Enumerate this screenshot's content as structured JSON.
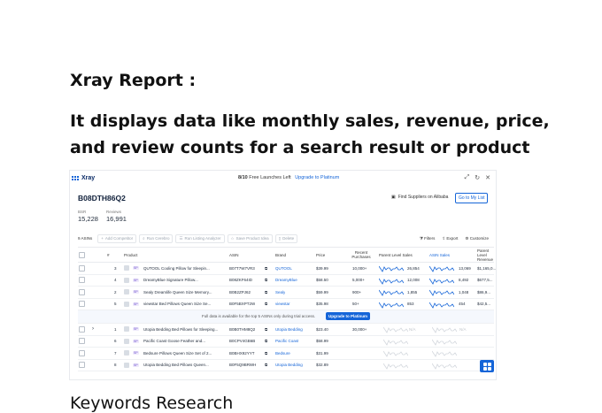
{
  "doc": {
    "heading": "Xray Report :",
    "description": "It displays data like monthly sales, revenue, price, and review counts for a search result or product page.",
    "next_heading": "Keywords Research"
  },
  "app": {
    "name": "Xray",
    "launches": "8/10",
    "launches_text": "Free Launches Left",
    "upgrade_link": "Upgrade to Platinum",
    "asin": "B08DTH86Q2",
    "bsr_label": "BSR",
    "bsr_value": "15,228",
    "reviews_label": "Reviews",
    "reviews_value": "16,991",
    "supplier_link": "Find Suppliers on Alibaba",
    "go_list": "Go to My List"
  },
  "toolbar": {
    "count": "9 ASINs",
    "buttons": [
      "Add Competitor",
      "Run Cerebro",
      "Run Listing Analyzer",
      "Save Product Idea",
      "Delete"
    ],
    "filters": "Filters",
    "export": "Export",
    "customize": "Customize"
  },
  "columns": [
    "#",
    "Product",
    "ASIN",
    "Brand",
    "Price",
    "Recent Purchases",
    "Parent Level Sales",
    "ASIN Sales",
    "Parent Level Revenue"
  ],
  "rows": [
    {
      "num": "3",
      "tag": "SP",
      "product": "QUTOOL Cooling Pillow for Sleepin...",
      "asin": "B07T7W7VR3",
      "brand": "QUTOOL",
      "price": "$39.99",
      "recent": "10,000+",
      "parent_sales": "26,854",
      "asin_sales": "13,069",
      "parent_rev": "$1,165,0..."
    },
    {
      "num": "4",
      "tag": "SP",
      "product": "DreamyBlue Signature Pillow...",
      "asin": "B08ZKF64ID",
      "brand": "DreamyBlue",
      "price": "$58.50",
      "recent": "5,000+",
      "parent_sales": "12,008",
      "asin_sales": "8,492",
      "parent_rev": "$677,5..."
    },
    {
      "num": "2",
      "tag": "SP",
      "product": "Sealy Dreamlife Queen Size Memory...",
      "asin": "B0B2ZPJ62",
      "brand": "Sealy",
      "price": "$59.99",
      "recent": "900+",
      "parent_sales": "1,855",
      "asin_sales": "1,048",
      "parent_rev": "$86,9..."
    },
    {
      "num": "5",
      "tag": "SP",
      "product": "viewstar Bed Pillows Queen Size Se...",
      "asin": "B0F5BXPT2W",
      "brand": "viewstar",
      "price": "$35.98",
      "recent": "50+",
      "parent_sales": "853",
      "asin_sales": "454",
      "parent_rev": "$42,5..."
    }
  ],
  "banner": {
    "message": "Full data is available for the top 5 ASINs only during trial access.",
    "button": "Upgrade to Platinum"
  },
  "locked_rows": [
    {
      "num": "1",
      "tag": "SP",
      "product": "Utopia Bedding Bed Pillows for Sleeping...",
      "asin": "B0B0THM8Q2",
      "brand": "Utopia Bedding",
      "price": "$23.40",
      "recent": "30,000+",
      "parent_sales": "N/A",
      "asin_sales": "N/A"
    },
    {
      "num": "6",
      "tag": "SP",
      "product": "Pacific Coast Goose Feather and...",
      "asin": "B0CPV4GB6B",
      "brand": "Pacific Coast",
      "price": "$58.99",
      "recent": "",
      "parent_sales": "",
      "asin_sales": ""
    },
    {
      "num": "7",
      "tag": "SP",
      "product": "Bedsure Pillows Queen Size Set of 2...",
      "asin": "B0BHX92YYT",
      "brand": "Bedsure",
      "price": "$31.99",
      "recent": "",
      "parent_sales": "",
      "asin_sales": ""
    },
    {
      "num": "8",
      "tag": "SP",
      "product": "Utopia Bedding Bed Pillows Queen...",
      "asin": "B0F5Q9BRWH",
      "brand": "Utopia Bedding",
      "price": "$32.89",
      "recent": "",
      "parent_sales": "",
      "asin_sales": ""
    }
  ],
  "colors": {
    "accent": "#1565d8",
    "tag": "#6b4dcc",
    "heading": "#0a2a66"
  }
}
